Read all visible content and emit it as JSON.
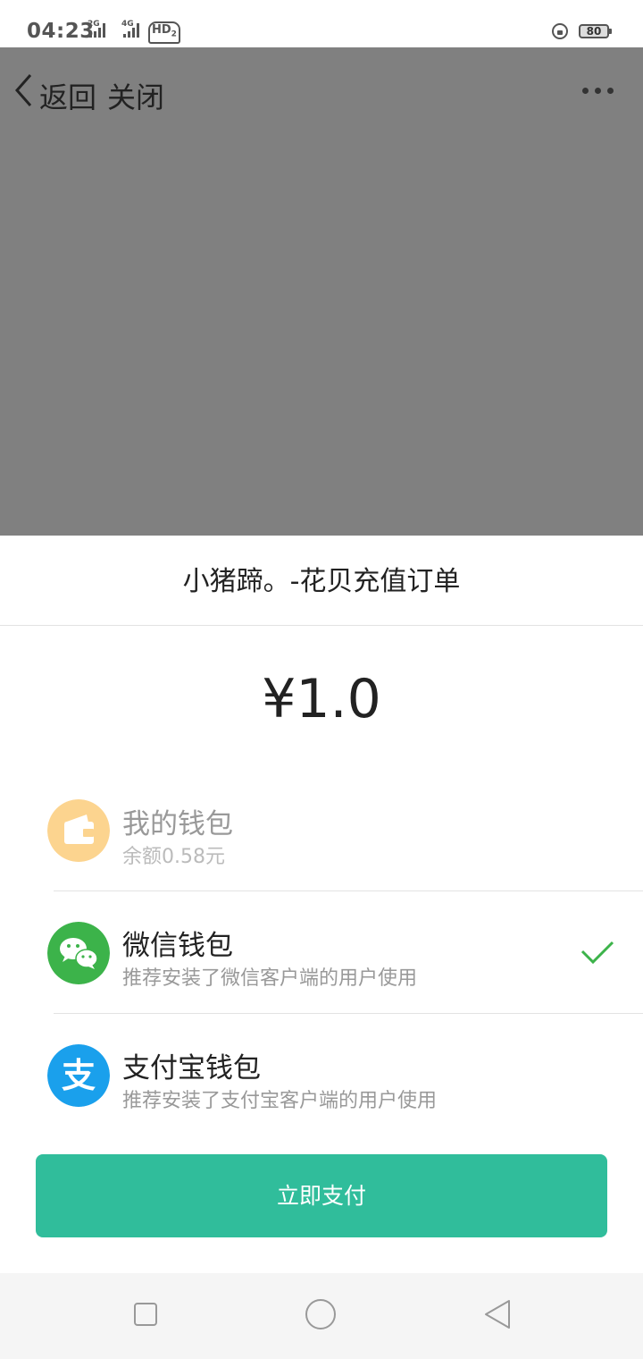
{
  "status_bar": {
    "time": "04:23",
    "network1": "2G",
    "network2": "4G",
    "hd": "HD",
    "hd_sub": "2",
    "battery": "80"
  },
  "nav": {
    "back_label": "返回",
    "close_label": "关闭",
    "more_icon": "more-icon"
  },
  "order": {
    "title": "小猪蹄。-花贝充值订单",
    "amount": "¥1.0"
  },
  "payment_options": [
    {
      "name": "我的钱包",
      "desc": "余额0.58元",
      "icon": "wallet-icon",
      "color": "#fcd48f",
      "enabled": false
    },
    {
      "name": "微信钱包",
      "desc": "推荐安装了微信客户端的用户使用",
      "icon": "wechat-icon",
      "color": "#3cb34a",
      "selected": true
    },
    {
      "name": "支付宝钱包",
      "desc": "推荐安装了支付宝客户端的用户使用",
      "icon": "alipay-icon",
      "color": "#1aa0ec"
    }
  ],
  "pay_button": {
    "label": "立即支付",
    "color": "#30bd9b"
  },
  "colors": {
    "overlay": "#808080",
    "check": "#3cb34a"
  }
}
